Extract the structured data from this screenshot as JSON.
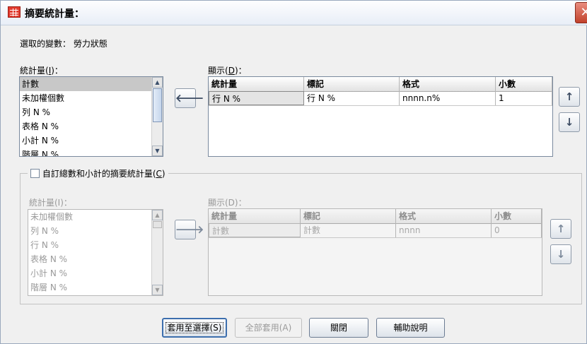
{
  "window": {
    "title": "摘要統計量：",
    "close_symbol": "✕"
  },
  "selected_var": {
    "label": "選取的變數：",
    "value": "勞力狀態"
  },
  "top": {
    "stats_label_text": "統計量(",
    "stats_label_key": "I",
    "stats_label_end": ")：",
    "stats_items": [
      "計數",
      "未加權個數",
      "列 N %",
      "表格 N %",
      "小計 N %",
      "階層 N %"
    ],
    "display_label_text": "顯示(",
    "display_label_key": "D",
    "display_label_end": ")：",
    "columns": [
      "統計量",
      "標記",
      "格式",
      "小數"
    ],
    "row": [
      "行 N %",
      "行 N %",
      "nnnn.n%",
      "1"
    ],
    "move_left_arrow": "🡐",
    "up_arrow": "↑",
    "down_arrow": "↓"
  },
  "custom": {
    "checkbox_label_text": "自訂總數和小計的摘要統計量(",
    "checkbox_label_key": "C",
    "checkbox_label_end": ")",
    "checked": false,
    "stats_label": "統計量(I)：",
    "stats_items": [
      "未加權個數",
      "列 N %",
      "行 N %",
      "表格 N %",
      "小計 N %",
      "階層 N %"
    ],
    "display_label": "顯示(D)：",
    "columns": [
      "統計量",
      "標記",
      "格式",
      "小數"
    ],
    "row": [
      "計數",
      "計數",
      "nnnn",
      "0"
    ],
    "move_right_arrow": "🡒",
    "up_arrow": "↑",
    "down_arrow": "↓"
  },
  "buttons": {
    "apply_selection": "套用至選擇(S)",
    "apply_all": "全部套用(A)",
    "close": "關閉",
    "help": "輔助說明"
  },
  "colors": {
    "accent": "#3d6fae",
    "close": "#c1412b",
    "icon": "#e23b2e"
  }
}
